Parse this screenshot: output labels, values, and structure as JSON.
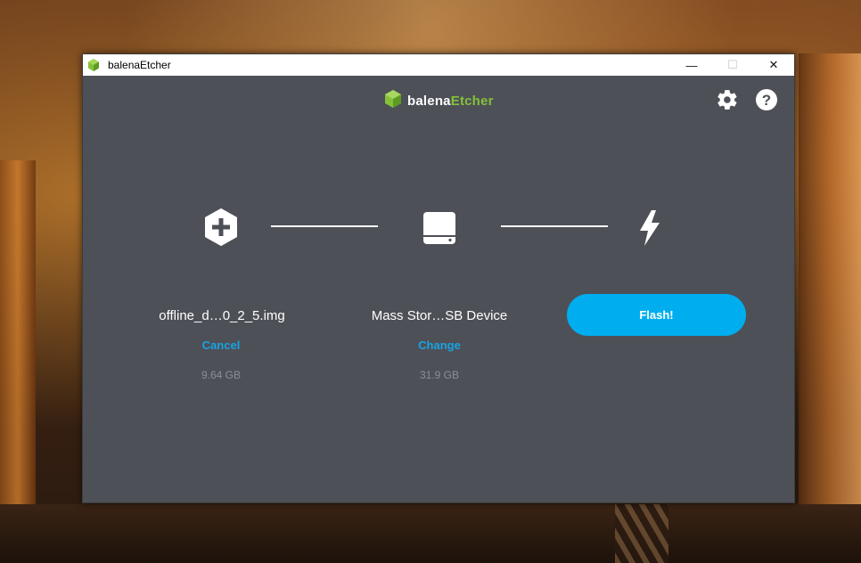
{
  "window": {
    "title": "balenaEtcher",
    "controls": {
      "minimize": "—",
      "maximize": "☐",
      "close": "✕"
    }
  },
  "header": {
    "logo_prefix": "balena",
    "logo_accent": "Etcher",
    "settings_icon": "gear-icon",
    "help_icon": "help-icon"
  },
  "steps": {
    "image": {
      "icon": "plus-hexagon-icon",
      "label": "offline_d…0_2_5.img",
      "action": "Cancel",
      "size": "9.64 GB"
    },
    "drive": {
      "icon": "drive-icon",
      "label": "Mass Stor…SB Device",
      "action": "Change",
      "size": "31.9 GB"
    },
    "flash": {
      "icon": "lightning-icon",
      "button": "Flash!"
    }
  },
  "colors": {
    "app_bg": "#4d5057",
    "accent_blue": "#00aeef",
    "link_blue": "#18a3e4",
    "logo_green": "#85c13a"
  }
}
